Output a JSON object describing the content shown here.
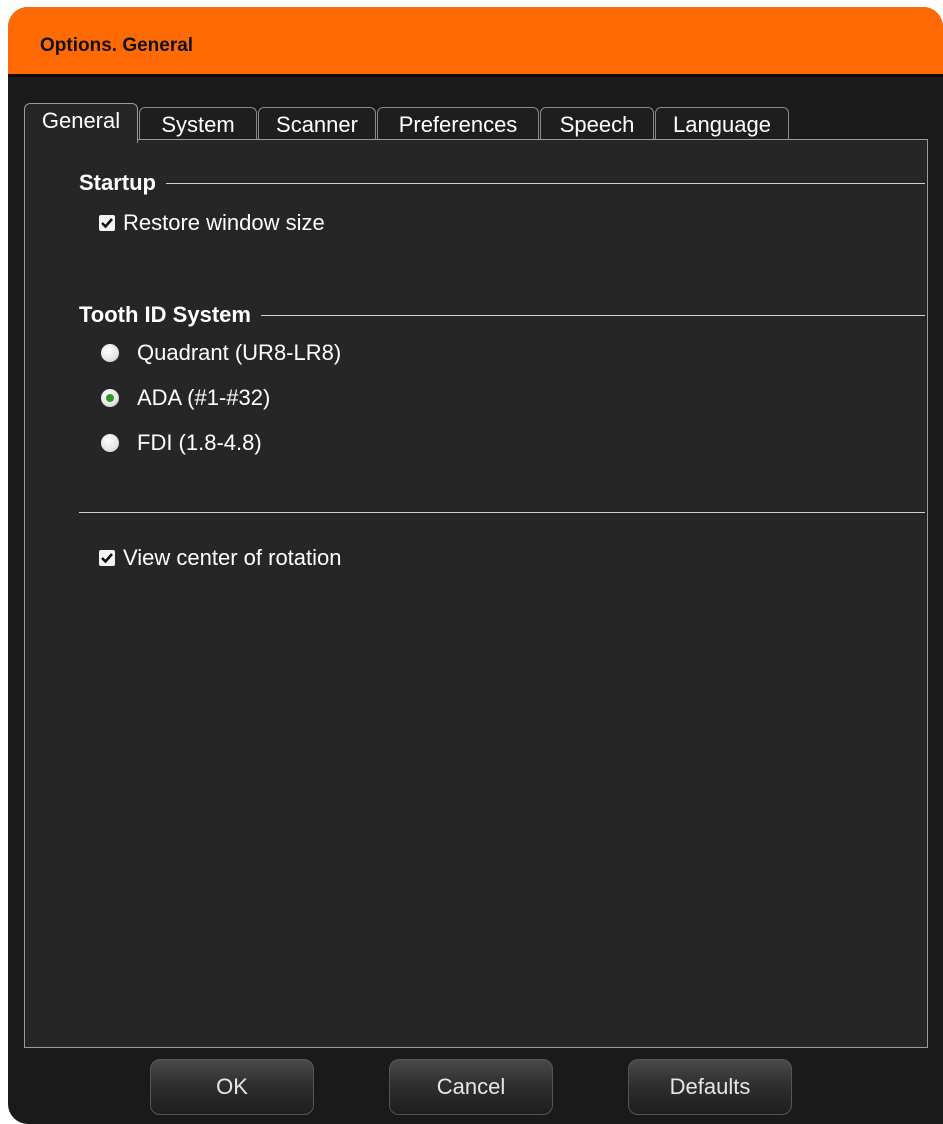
{
  "window": {
    "title": "Options. General"
  },
  "tabs": [
    {
      "label": "General"
    },
    {
      "label": "System"
    },
    {
      "label": "Scanner"
    },
    {
      "label": "Preferences"
    },
    {
      "label": "Speech"
    },
    {
      "label": "Language"
    }
  ],
  "active_tab": "General",
  "startup": {
    "header": "Startup",
    "restore_window": {
      "label": "Restore window size",
      "checked": true
    }
  },
  "tooth_id": {
    "header": "Tooth ID System",
    "options": [
      {
        "label": "Quadrant (UR8-LR8)",
        "selected": false
      },
      {
        "label": "ADA (#1-#32)",
        "selected": true
      },
      {
        "label": "FDI (1.8-4.8)",
        "selected": false
      }
    ]
  },
  "view_center": {
    "label": "View center of rotation",
    "checked": true
  },
  "buttons": {
    "ok": "OK",
    "cancel": "Cancel",
    "defaults": "Defaults"
  },
  "colors": {
    "accent": "#ff6a05",
    "background": "#262626",
    "radio_selected": "#2d9a2d"
  }
}
